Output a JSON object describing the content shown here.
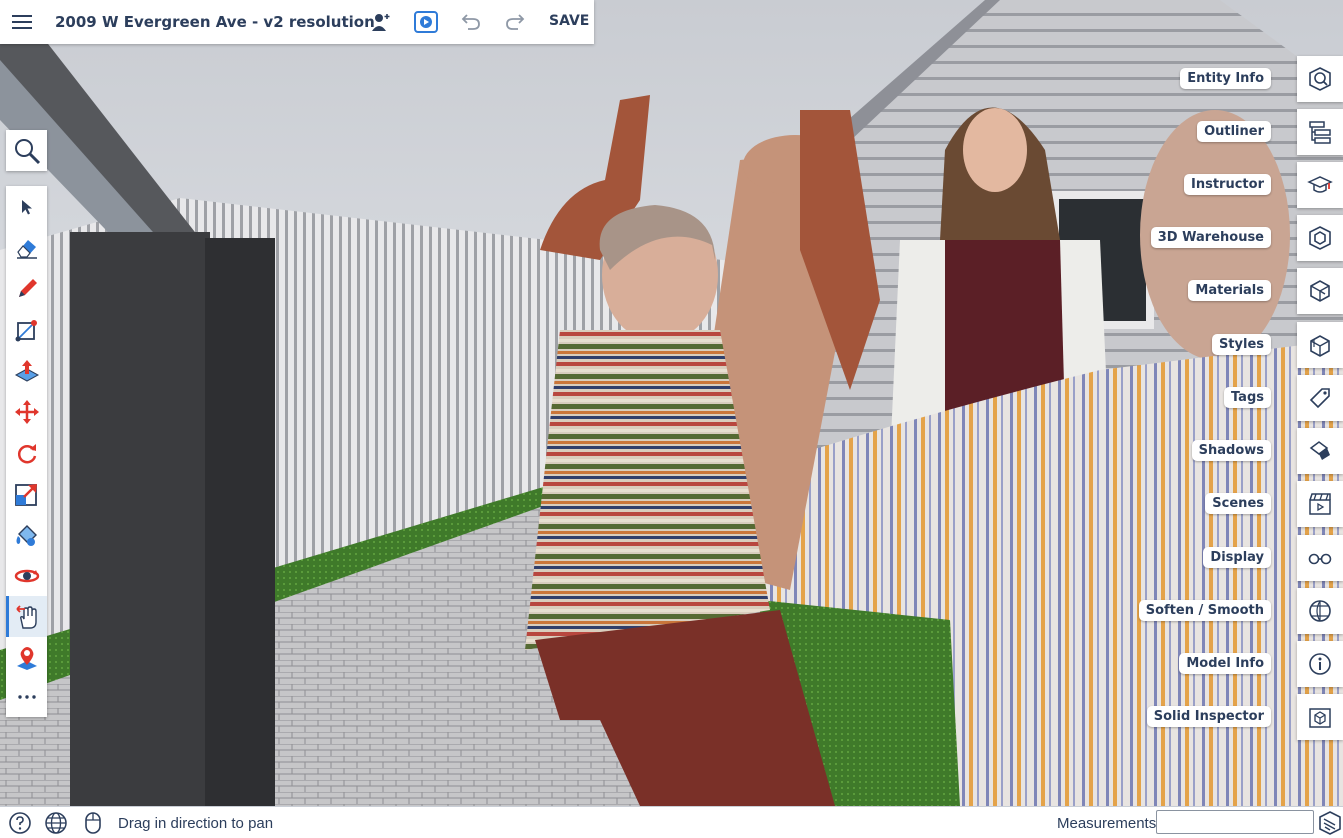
{
  "header": {
    "title": "2009 W Evergreen Ave - v2 resolution",
    "save_label": "SAVE",
    "menu_icon": "hamburger-icon",
    "icons": [
      "hamburger-icon",
      "add-collaborator-icon",
      "presentation-play-icon",
      "undo-icon",
      "redo-icon"
    ]
  },
  "left_toolbar": {
    "search_icon": "search-icon",
    "tools": [
      {
        "name": "select-tool",
        "icon": "arrow-icon"
      },
      {
        "name": "eraser-tool",
        "icon": "eraser-icon"
      },
      {
        "name": "pencil-tool",
        "icon": "pencil-icon"
      },
      {
        "name": "rectangle-tool",
        "icon": "rectangle-icon"
      },
      {
        "name": "push-pull-tool",
        "icon": "push-pull-icon"
      },
      {
        "name": "move-tool",
        "icon": "move-icon"
      },
      {
        "name": "rotate-tool",
        "icon": "rotate-icon"
      },
      {
        "name": "scale-tool",
        "icon": "scale-icon"
      },
      {
        "name": "paint-bucket-tool",
        "icon": "paint-icon"
      },
      {
        "name": "orbit-tool",
        "icon": "orbit-icon"
      },
      {
        "name": "pan-tool",
        "icon": "hand-icon",
        "active": true
      },
      {
        "name": "position-camera-tool",
        "icon": "camera-position-icon"
      },
      {
        "name": "more-tools",
        "icon": "ellipsis-icon"
      }
    ]
  },
  "right_panels": [
    {
      "label": "Entity Info",
      "icon": "entity-info-icon"
    },
    {
      "label": "Outliner",
      "icon": "outliner-icon"
    },
    {
      "label": "Instructor",
      "icon": "instructor-icon"
    },
    {
      "label": "3D Warehouse",
      "icon": "warehouse-icon"
    },
    {
      "label": "Materials",
      "icon": "materials-icon"
    },
    {
      "label": "Styles",
      "icon": "styles-icon"
    },
    {
      "label": "Tags",
      "icon": "tag-icon"
    },
    {
      "label": "Shadows",
      "icon": "shadows-icon"
    },
    {
      "label": "Scenes",
      "icon": "scenes-icon"
    },
    {
      "label": "Display",
      "icon": "glasses-icon"
    },
    {
      "label": "Soften / Smooth",
      "icon": "soften-icon"
    },
    {
      "label": "Model Info",
      "icon": "info-icon"
    },
    {
      "label": "Solid Inspector",
      "icon": "solid-inspector-icon"
    }
  ],
  "status_bar": {
    "hint": "Drag in direction to pan",
    "measurements_label": "Measurements",
    "measurements_value": "",
    "icons": [
      "help-icon",
      "globe-icon",
      "mouse-icon",
      "sketchup-logo-icon"
    ]
  },
  "colors": {
    "accent": "#2f7bd8",
    "text": "#2c3e5c",
    "tool_red": "#e0362c"
  }
}
